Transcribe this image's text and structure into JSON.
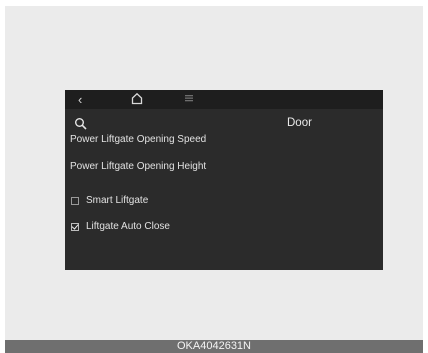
{
  "nav": {
    "back_icon": "chevron-left-icon",
    "home_icon": "home-icon",
    "menu_icon": "menu-icon"
  },
  "header": {
    "search_icon": "search-icon",
    "title": "Door"
  },
  "settings": {
    "items": [
      {
        "label": "Power Liftgate Opening Speed"
      },
      {
        "label": "Power Liftgate Opening Height"
      }
    ],
    "checkboxes": [
      {
        "label": "Smart Liftgate",
        "checked": false
      },
      {
        "label": "Liftgate Auto Close",
        "checked": true
      }
    ]
  },
  "caption": "OKA4042631N",
  "colors": {
    "screen_bg": "#2b2b2b",
    "top_bar_bg": "#1e1e1e",
    "frame_bg": "#ebebeb",
    "caption_bg": "#6f6f6f",
    "text": "#e2e2e2"
  }
}
